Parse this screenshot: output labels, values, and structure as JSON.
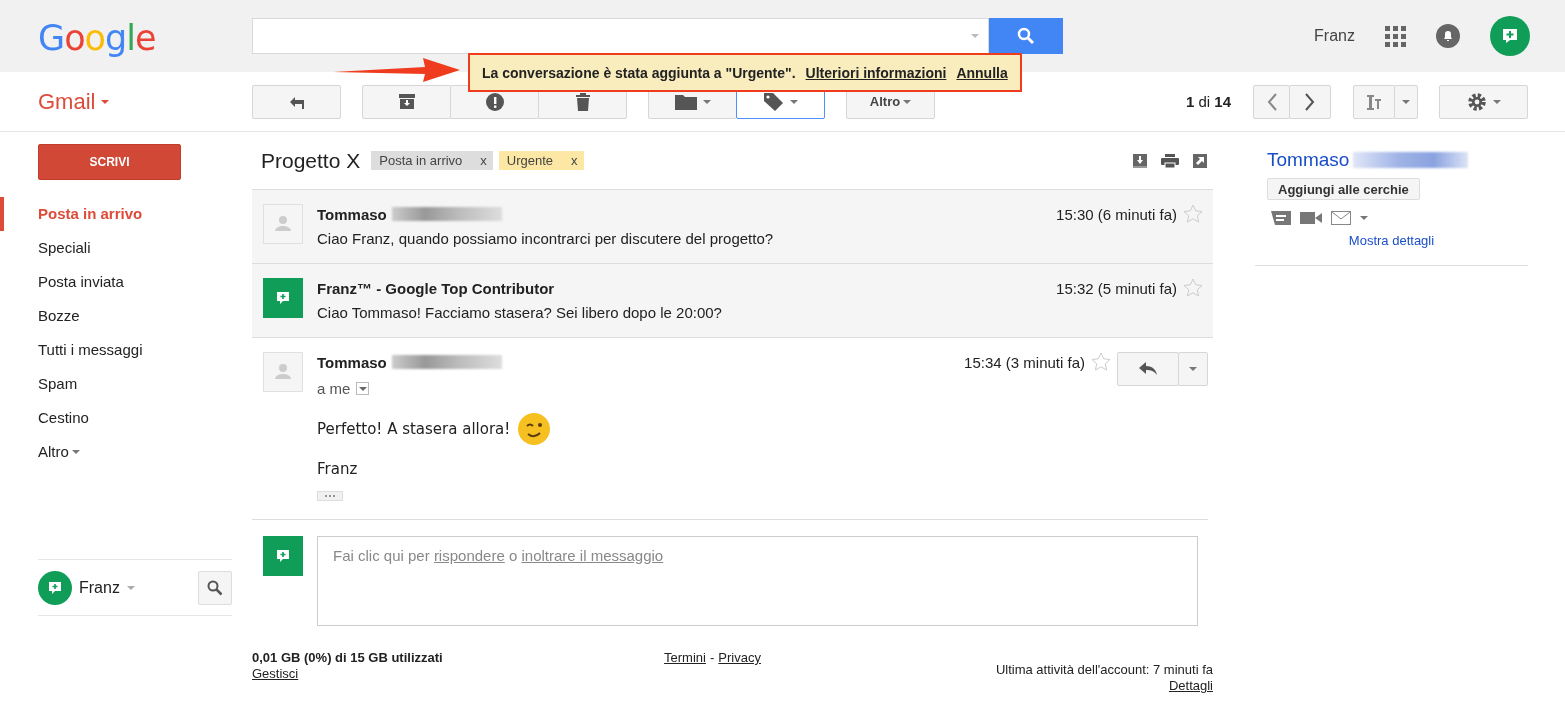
{
  "header": {
    "logo": "Google",
    "user_name": "Franz"
  },
  "toolbar": {
    "app_menu": "Gmail",
    "more_button": "Altro",
    "pagination": "**1** di **14**"
  },
  "notification": {
    "message": "La conversazione è stata aggiunta a \"Urgente\".",
    "links": [
      "Ulteriori informazioni",
      "Annulla"
    ]
  },
  "sidebar": {
    "compose": "SCRIVI",
    "items": [
      {
        "label": "Posta in arrivo",
        "selected": true
      },
      {
        "label": "Speciali",
        "selected": false
      },
      {
        "label": "Posta inviata",
        "selected": false
      },
      {
        "label": "Bozze",
        "selected": false
      },
      {
        "label": "Tutti i messaggi",
        "selected": false
      },
      {
        "label": "Spam",
        "selected": false
      },
      {
        "label": "Cestino",
        "selected": false
      }
    ],
    "more": "Altro",
    "chat_user": "Franz"
  },
  "thread": {
    "subject": "Progetto X",
    "labels": [
      {
        "name": "Posta in arrivo",
        "remove": "x",
        "color": "#dddddd"
      },
      {
        "name": "Urgente",
        "remove": "x",
        "color": "#fce8a4"
      }
    ],
    "messages": [
      {
        "kind": "person",
        "sender": "Tommaso",
        "redacted": true,
        "time": "15:30 (6 minuti fa)",
        "snippet": "Ciao Franz, quando possiamo incontrarci per discutere del progetto?",
        "expanded": false,
        "starred": false
      },
      {
        "kind": "hangouts",
        "sender": "Franz™ - Google Top Contributor",
        "redacted": false,
        "time": "15:32 (5 minuti fa)",
        "snippet": "Ciao Tommaso! Facciamo stasera? Sei libero dopo le 20:00?",
        "expanded": false,
        "starred": false
      },
      {
        "kind": "person",
        "sender": "Tommaso",
        "redacted": true,
        "time": "15:34 (3 minuti fa)",
        "recipient": "a me",
        "body": [
          "Perfetto! A stasera allora!",
          "Franz"
        ],
        "expanded": true,
        "starred": false
      }
    ],
    "reply_box": {
      "prefix": "Fai clic qui per",
      "reply_link": "rispondere",
      "middle": "o",
      "forward_link": "inoltrare il messaggio"
    }
  },
  "contact_card": {
    "name": "Tommaso",
    "add_button": "Aggiungi alle cerchie",
    "details_link": "Mostra dettagli"
  },
  "footer": {
    "storage": "0,01 GB (0%) di 15 GB utilizzati",
    "manage": "Gestisci",
    "terms": "Termini",
    "separator": "-",
    "privacy": "Privacy",
    "last_activity": "Ultima attività dell'account: 7 minuti fa",
    "details": "Dettagli"
  }
}
